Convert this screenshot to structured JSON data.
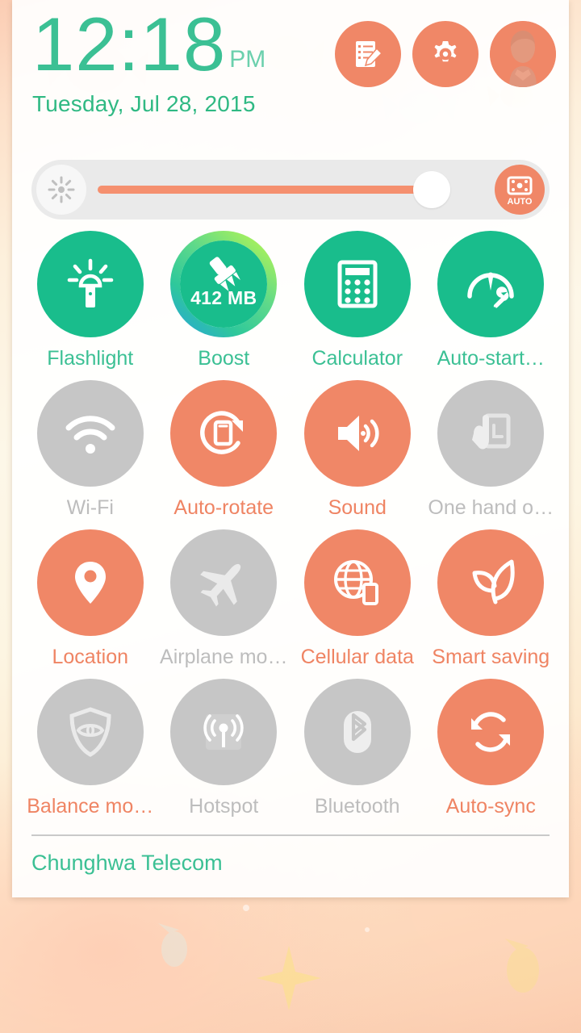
{
  "status_panel": {
    "clock": {
      "time": "12:18",
      "meridiem": "PM",
      "date": "Tuesday, Jul 28, 2015"
    },
    "header_actions": [
      {
        "name": "notes-edit-button",
        "icon": "notes-edit-icon",
        "label": "Edit notes"
      },
      {
        "name": "settings-button",
        "icon": "gear-icon",
        "label": "Settings"
      },
      {
        "name": "user-profile-button",
        "icon": "avatar-icon",
        "label": "User profile"
      }
    ],
    "brightness": {
      "icon": "brightness-sun-icon",
      "level_percent": 88,
      "auto_label": "AUTO",
      "auto_icon": "auto-brightness-sensor-icon",
      "auto_enabled": true
    },
    "toggles": [
      {
        "label": "Flashlight",
        "icon": "flashlight-icon",
        "state": "on",
        "color": "green",
        "name": "toggle-flashlight"
      },
      {
        "label": "Boost",
        "icon": "boost-brush-icon",
        "state": "on",
        "color": "green",
        "name": "toggle-boost",
        "badge": "412 MB"
      },
      {
        "label": "Calculator",
        "icon": "calculator-icon",
        "state": "on",
        "color": "green",
        "name": "toggle-calculator"
      },
      {
        "label": "Auto-start…",
        "icon": "auto-start-gauge-wrench-icon",
        "state": "on",
        "color": "green",
        "name": "toggle-auto-start"
      },
      {
        "label": "Wi-Fi",
        "icon": "wifi-icon",
        "state": "off",
        "color": "gray",
        "name": "toggle-wifi"
      },
      {
        "label": "Auto-rotate",
        "icon": "auto-rotate-icon",
        "state": "on",
        "color": "orange",
        "name": "toggle-auto-rotate"
      },
      {
        "label": "Sound",
        "icon": "sound-speaker-icon",
        "state": "on",
        "color": "orange",
        "name": "toggle-sound"
      },
      {
        "label": "One hand o…",
        "icon": "one-hand-operation-icon",
        "state": "off",
        "color": "gray",
        "name": "toggle-one-hand-operation"
      },
      {
        "label": "Location",
        "icon": "location-pin-icon",
        "state": "on",
        "color": "orange",
        "name": "toggle-location"
      },
      {
        "label": "Airplane mo…",
        "icon": "airplane-icon",
        "state": "off",
        "color": "gray",
        "name": "toggle-airplane-mode"
      },
      {
        "label": "Cellular data",
        "icon": "cellular-data-globe-icon",
        "state": "on",
        "color": "orange",
        "name": "toggle-cellular-data"
      },
      {
        "label": "Smart saving",
        "icon": "leaf-icon",
        "state": "on",
        "color": "orange",
        "name": "toggle-smart-saving"
      },
      {
        "label": "Balance mo…",
        "icon": "shield-eye-icon",
        "state": "off",
        "color": "gray",
        "label_color": "orange",
        "name": "toggle-balance-mode"
      },
      {
        "label": "Hotspot",
        "icon": "hotspot-antenna-icon",
        "state": "off",
        "color": "gray",
        "name": "toggle-hotspot"
      },
      {
        "label": "Bluetooth",
        "icon": "bluetooth-icon",
        "state": "off",
        "color": "gray",
        "name": "toggle-bluetooth"
      },
      {
        "label": "Auto-sync",
        "icon": "auto-sync-icon",
        "state": "on",
        "color": "orange",
        "name": "toggle-auto-sync"
      }
    ],
    "footer": {
      "carrier": "Chunghwa Telecom"
    },
    "colors": {
      "accent_green": "#19bd8c",
      "label_green": "#3bc094",
      "accent_orange": "#f08767",
      "label_orange": "#ef8463",
      "disabled_gray": "#c6c6c6",
      "label_gray": "#bdbdbd",
      "panel_bg": "#ffffff",
      "slider_track": "#eaeaea",
      "slider_fill": "#f5906f"
    }
  }
}
